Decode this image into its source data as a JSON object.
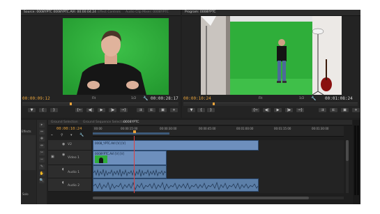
{
  "source_monitor": {
    "tab_label": "Source: 0008YPTC 0008YPTC.AVI: 00:00:04:24",
    "other_tabs": [
      "Effect Controls",
      "Audio Clip Mixer: 0008YPTC"
    ],
    "timecode_in": "00:00:09:12",
    "fit_label": "Fit",
    "duration": "00:00:28:17",
    "zoom_label": "1/2"
  },
  "program_monitor": {
    "tab_label": "Program: 0008YPTC",
    "timecode_in": "00:00:10:24",
    "fit_label": "Fit",
    "duration": "00:01:08:24",
    "zoom_label": "1/2"
  },
  "transport_buttons": [
    "▼",
    "{",
    "}",
    "{←",
    "◀|",
    "▶",
    "|▶",
    "→}",
    "⇉",
    "⇇",
    "▣",
    "+"
  ],
  "project_panel": {
    "label": "Effects",
    "tools": [
      "▸",
      "⇔",
      "✥",
      "⇹",
      "✂",
      "⇿",
      "✎",
      "✋",
      "🔍"
    ],
    "bottom_label": "Solo"
  },
  "timeline": {
    "tabs": [
      "Ground Selection",
      "Ground Sequence Selection",
      "0008YPTC"
    ],
    "active_tab": 2,
    "timecode": "00:00:10:24",
    "ruler_labels": [
      "00:00",
      "00:00:15:00",
      "00:00:30:00",
      "00:00:45:00",
      "00:01:00:00",
      "00:01:15:00",
      "00:01:30:00"
    ],
    "tracks": [
      {
        "id": "V2",
        "label": "V2"
      },
      {
        "id": "V1",
        "label": "Video 1"
      },
      {
        "id": "A1",
        "label": "Audio 1"
      },
      {
        "id": "A2",
        "label": "Audio 2"
      }
    ],
    "clips": [
      {
        "track": "V2",
        "label": "0008_YPTC.AVI [V] [V]"
      },
      {
        "track": "V1",
        "label": "0008YPTC.AVI [V] [V]"
      }
    ]
  },
  "colors": {
    "timecode_orange": "#e8a33c",
    "greenscreen": "#2fae3a",
    "clip_video": "#6d8fbd",
    "clip_audio": "#5c7fa8",
    "playhead": "#e04040"
  },
  "icons": [
    "wrench-icon",
    "camera-icon",
    "play-icon",
    "step-forward-icon",
    "step-back-icon",
    "marker-icon",
    "lift-icon",
    "extract-icon",
    "export-frame-icon",
    "selection-tool-icon",
    "razor-tool-icon",
    "hand-tool-icon",
    "zoom-tool-icon",
    "eye-icon",
    "lock-icon",
    "speaker-icon"
  ]
}
